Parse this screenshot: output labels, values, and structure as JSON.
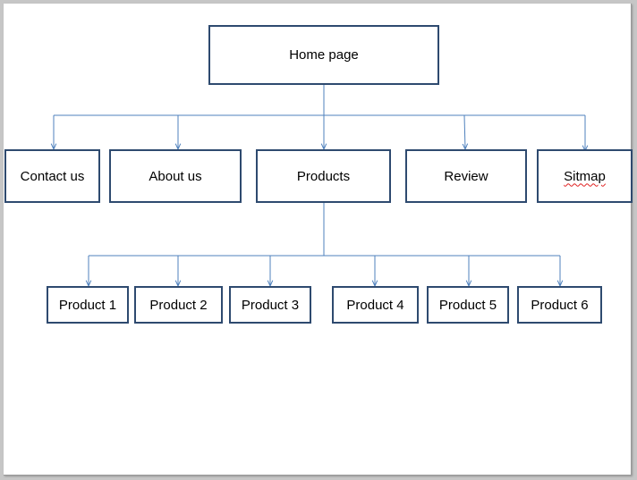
{
  "diagram": {
    "root": {
      "label": "Home page"
    },
    "level1": [
      {
        "label": "Contact us"
      },
      {
        "label": "About us"
      },
      {
        "label": "Products"
      },
      {
        "label": "Review"
      },
      {
        "label": "Sitmap"
      }
    ],
    "level2": [
      {
        "label": "Product 1"
      },
      {
        "label": "Product 2"
      },
      {
        "label": "Product 3"
      },
      {
        "label": "Product 4"
      },
      {
        "label": "Product 5"
      },
      {
        "label": "Product 6"
      }
    ],
    "edges": [
      {
        "from": "Home page",
        "to": "Contact us"
      },
      {
        "from": "Home page",
        "to": "About us"
      },
      {
        "from": "Home page",
        "to": "Products"
      },
      {
        "from": "Home page",
        "to": "Review"
      },
      {
        "from": "Home page",
        "to": "Sitmap"
      },
      {
        "from": "Products",
        "to": "Product 1"
      },
      {
        "from": "Products",
        "to": "Product 2"
      },
      {
        "from": "Products",
        "to": "Product 3"
      },
      {
        "from": "Products",
        "to": "Product 4"
      },
      {
        "from": "Products",
        "to": "Product 5"
      },
      {
        "from": "Products",
        "to": "Product 6"
      }
    ],
    "colors": {
      "box_border": "#2e4a6f",
      "connector": "#4f81bd"
    }
  }
}
